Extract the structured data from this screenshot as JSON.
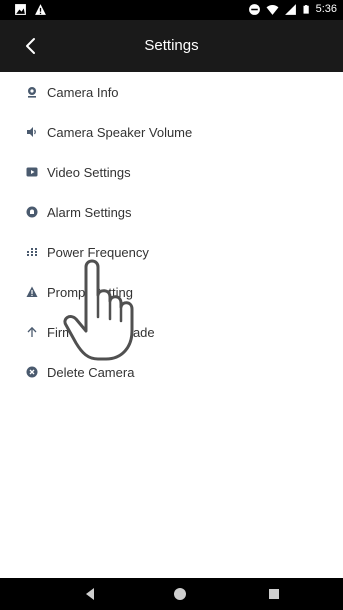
{
  "status_bar": {
    "time": "5:36",
    "left_icons": [
      "image-icon",
      "warning-icon"
    ],
    "right_icons": [
      "do-not-disturb-icon",
      "wifi-icon",
      "cell-signal-icon",
      "battery-icon"
    ]
  },
  "header": {
    "title": "Settings",
    "back_icon": "chevron-left-icon"
  },
  "menu": {
    "items": [
      {
        "label": "Camera Info",
        "icon": "camera-icon"
      },
      {
        "label": "Camera Speaker Volume",
        "icon": "speaker-icon"
      },
      {
        "label": "Video Settings",
        "icon": "video-icon"
      },
      {
        "label": "Alarm Settings",
        "icon": "alarm-icon"
      },
      {
        "label": "Power Frequency",
        "icon": "frequency-icon"
      },
      {
        "label": "Prompt Setting",
        "icon": "warning-icon"
      },
      {
        "label": "Firmware Upgrade",
        "icon": "arrow-up-icon"
      },
      {
        "label": "Delete Camera",
        "icon": "delete-icon"
      }
    ]
  },
  "nav_bar": {
    "buttons": [
      "back-triangle-icon",
      "home-circle-icon",
      "recents-square-icon"
    ]
  },
  "colors": {
    "app_bar": "#1a1a1a",
    "icon": "#4a5a6e",
    "text": "#333333"
  }
}
